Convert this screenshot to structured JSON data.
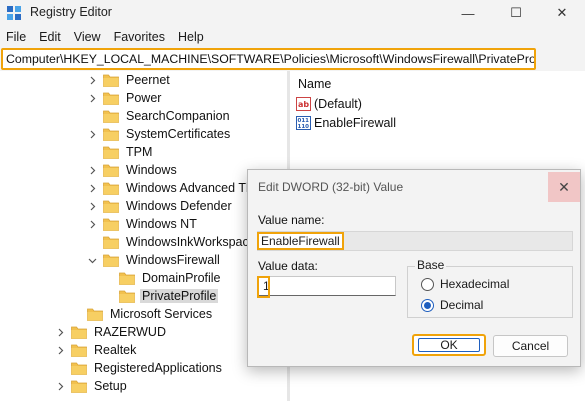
{
  "window": {
    "title": "Registry Editor",
    "minimize_glyph": "—",
    "maximize_glyph": "☐",
    "close_glyph": "✕"
  },
  "menu": [
    "File",
    "Edit",
    "View",
    "Favorites",
    "Help"
  ],
  "address": "Computer\\HKEY_LOCAL_MACHINE\\SOFTWARE\\Policies\\Microsoft\\WindowsFirewall\\PrivateProfile",
  "tree": [
    {
      "label": "Peernet",
      "chevron": true,
      "level": 2,
      "selected": false
    },
    {
      "label": "Power",
      "chevron": true,
      "level": 2,
      "selected": false
    },
    {
      "label": "SearchCompanion",
      "chevron": false,
      "level": 2,
      "selected": false
    },
    {
      "label": "SystemCertificates",
      "chevron": true,
      "level": 2,
      "selected": false
    },
    {
      "label": "TPM",
      "chevron": false,
      "level": 2,
      "selected": false
    },
    {
      "label": "Windows",
      "chevron": true,
      "level": 2,
      "selected": false
    },
    {
      "label": "Windows Advanced Threat Protection",
      "chevron": true,
      "level": 2,
      "selected": false
    },
    {
      "label": "Windows Defender",
      "chevron": true,
      "level": 2,
      "selected": false
    },
    {
      "label": "Windows NT",
      "chevron": true,
      "level": 2,
      "selected": false
    },
    {
      "label": "WindowsInkWorkspace",
      "chevron": false,
      "level": 2,
      "selected": false
    },
    {
      "label": "WindowsFirewall",
      "chevron": true,
      "expanded": true,
      "level": 2,
      "selected": false
    },
    {
      "label": "DomainProfile",
      "chevron": false,
      "level": 3,
      "selected": false
    },
    {
      "label": "PrivateProfile",
      "chevron": false,
      "level": 3,
      "selected": true
    },
    {
      "label": "Microsoft Services",
      "chevron": false,
      "level": 1,
      "selected": false
    },
    {
      "label": "RAZERWUD",
      "chevron": true,
      "level": 0,
      "selected": false
    },
    {
      "label": "Realtek",
      "chevron": true,
      "level": 0,
      "selected": false
    },
    {
      "label": "RegisteredApplications",
      "chevron": false,
      "level": 0,
      "selected": false
    },
    {
      "label": "Setup",
      "chevron": true,
      "level": 0,
      "selected": false
    }
  ],
  "values_pane": {
    "column_name": "Name",
    "entries": [
      {
        "label": "(Default)",
        "icon": "string-value-icon"
      },
      {
        "label": "EnableFirewall",
        "icon": "dword-value-icon"
      }
    ]
  },
  "dialog": {
    "title": "Edit DWORD (32-bit) Value",
    "close_glyph": "✕",
    "value_name_label": "Value name:",
    "value_name": "EnableFirewall",
    "value_data_label": "Value data:",
    "value_data": "1",
    "base_label": "Base",
    "base_options": [
      {
        "label": "Hexadecimal",
        "checked": false
      },
      {
        "label": "Decimal",
        "checked": true
      }
    ],
    "ok_label": "OK",
    "cancel_label": "Cancel"
  },
  "colors": {
    "highlight": "#f0a30a",
    "folder": "#f2c14e",
    "accent": "#1f5fbf"
  }
}
